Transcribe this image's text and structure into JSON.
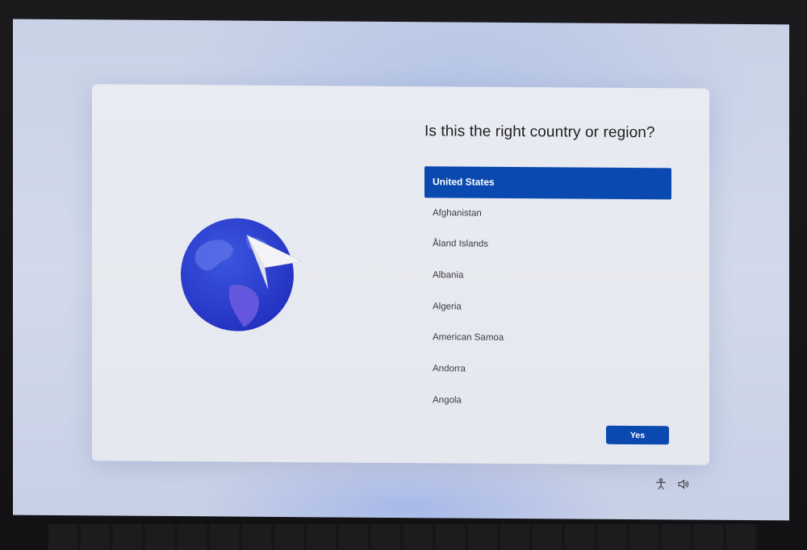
{
  "dialog": {
    "question": "Is this the right country or region?",
    "countries": [
      "United States",
      "Afghanistan",
      "Åland Islands",
      "Albania",
      "Algeria",
      "American Samoa",
      "Andorra",
      "Angola"
    ],
    "selected_country": "United States",
    "yes_label": "Yes"
  },
  "tray": {
    "icons": [
      "accessibility-icon",
      "volume-icon"
    ]
  },
  "colors": {
    "accent": "#0a49b0",
    "globe": "#2a3fd0",
    "panel": "#e9ebf2"
  }
}
